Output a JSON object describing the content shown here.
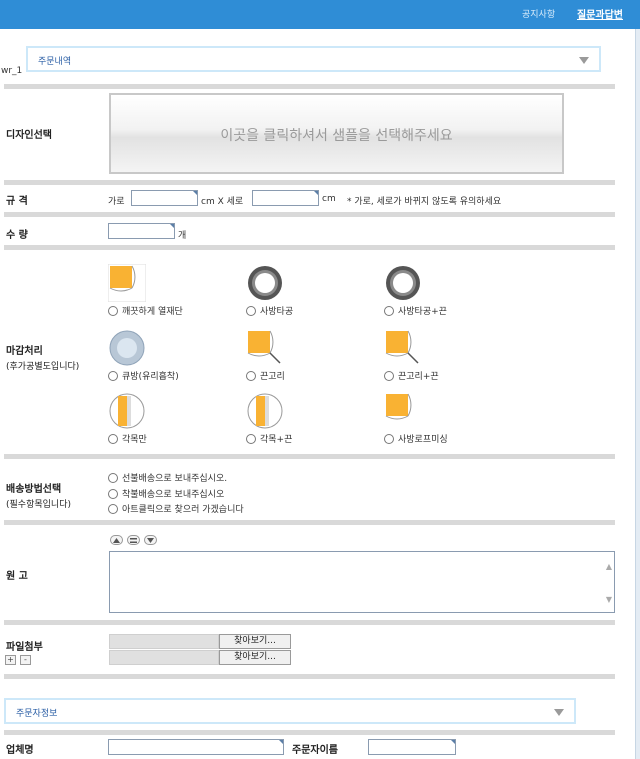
{
  "header": {
    "notice": "공지사항",
    "qna": "질문과답변"
  },
  "section_order": {
    "label": "주문내역"
  },
  "wr": "wr_1",
  "design": {
    "label": "디자인선택",
    "sample_text": "이곳을 클릭하셔서 샘플을 선택해주세요"
  },
  "size": {
    "label": "규 격",
    "width_label": "가로",
    "unit_x": "cm X 세로",
    "unit_cm": "cm",
    "note": "* 가로, 세로가 바뀌지 않도록 유의하세요"
  },
  "qty": {
    "label": "수 량",
    "unit": "개"
  },
  "finish": {
    "label": "마감처리",
    "sub": "(후가공별도입니다)",
    "options": [
      "깨끗하게 열재단",
      "사방타공",
      "사방타공+끈",
      "큐방(유리흡착)",
      "끈고리",
      "끈고리+끈",
      "각목만",
      "각목+끈",
      "사방로프미싱"
    ]
  },
  "shipping": {
    "label": "배송방법선택",
    "sub": "(필수항목입니다)",
    "options": [
      "선불배송으로 보내주십시오.",
      "착불배송으로 보내주십시오",
      "아트클릭으로 찾으러 가겠습니다"
    ]
  },
  "manuscript": {
    "label": "원 고"
  },
  "attach": {
    "label": "파일첨부",
    "browse1": "찾아보기...",
    "browse2": "찾아보기...",
    "plus": "+",
    "minus": "-"
  },
  "section_orderer": {
    "label": "주문자정보"
  },
  "orderer": {
    "company_label": "업체명",
    "name_label": "주문자이름"
  },
  "colors": {
    "topbar": "#2f8dd6",
    "accent": "#f9b233",
    "ring": "#555555",
    "section_border": "#cde8f9"
  },
  "icons": [
    "quarter-orange-icon",
    "grommet-ring-icon",
    "grommet-ring-icon",
    "suction-cup-icon",
    "corner-loop-icon",
    "corner-loop-icon",
    "wood-bar-icon",
    "wood-bar-icon",
    "corner-rope-icon"
  ]
}
